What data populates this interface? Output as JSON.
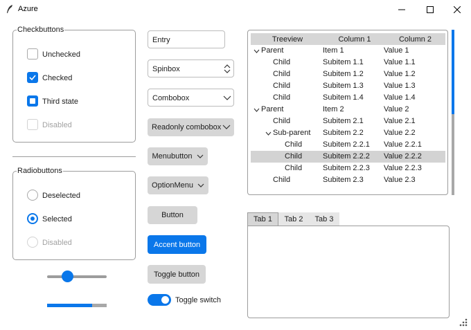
{
  "window": {
    "title": "Azure"
  },
  "checkbuttons": {
    "legend": "Checkbuttons",
    "items": [
      {
        "label": "Unchecked",
        "state": "unchecked"
      },
      {
        "label": "Checked",
        "state": "checked"
      },
      {
        "label": "Third state",
        "state": "indeterminate"
      },
      {
        "label": "Disabled",
        "state": "disabled"
      }
    ]
  },
  "radiobuttons": {
    "legend": "Radiobuttons",
    "items": [
      {
        "label": "Deselected",
        "state": "deselected"
      },
      {
        "label": "Selected",
        "state": "selected"
      },
      {
        "label": "Disabled",
        "state": "disabled"
      }
    ]
  },
  "scale": {
    "value": 0.3
  },
  "progress": {
    "value": 0.75
  },
  "widgets": {
    "entry_value": "Entry",
    "spinbox_value": "Spinbox",
    "combobox_value": "Combobox",
    "readonly_combobox_value": "Readonly combobox",
    "menubutton_label": "Menubutton",
    "optionmenu_label": "OptionMenu",
    "button_label": "Button",
    "accent_button_label": "Accent button",
    "toggle_button_label": "Toggle button",
    "toggle_switch_label": "Toggle switch",
    "toggle_switch_on": true
  },
  "treeview": {
    "headings": [
      "Treeview",
      "Column 1",
      "Column 2"
    ],
    "rows": [
      {
        "name": "Parent",
        "c1": "Item 1",
        "c2": "Value 1",
        "level": 0,
        "expander": true,
        "selected": false
      },
      {
        "name": "Child",
        "c1": "Subitem 1.1",
        "c2": "Value 1.1",
        "level": 1,
        "expander": false,
        "selected": false
      },
      {
        "name": "Child",
        "c1": "Subitem 1.2",
        "c2": "Value 1.2",
        "level": 1,
        "expander": false,
        "selected": false
      },
      {
        "name": "Child",
        "c1": "Subitem 1.3",
        "c2": "Value 1.3",
        "level": 1,
        "expander": false,
        "selected": false
      },
      {
        "name": "Child",
        "c1": "Subitem 1.4",
        "c2": "Value 1.4",
        "level": 1,
        "expander": false,
        "selected": false
      },
      {
        "name": "Parent",
        "c1": "Item 2",
        "c2": "Value 2",
        "level": 0,
        "expander": true,
        "selected": false
      },
      {
        "name": "Child",
        "c1": "Subitem 2.1",
        "c2": "Value 2.1",
        "level": 1,
        "expander": false,
        "selected": false
      },
      {
        "name": "Sub-parent",
        "c1": "Subitem 2.2",
        "c2": "Value 2.2",
        "level": 1,
        "expander": true,
        "selected": false
      },
      {
        "name": "Child",
        "c1": "Subitem 2.2.1",
        "c2": "Value 2.2.1",
        "level": 2,
        "expander": false,
        "selected": false
      },
      {
        "name": "Child",
        "c1": "Subitem 2.2.2",
        "c2": "Value 2.2.2",
        "level": 2,
        "expander": false,
        "selected": true
      },
      {
        "name": "Child",
        "c1": "Subitem 2.2.3",
        "c2": "Value 2.2.3",
        "level": 2,
        "expander": false,
        "selected": false
      },
      {
        "name": "Child",
        "c1": "Subitem 2.3",
        "c2": "Value 2.3",
        "level": 1,
        "expander": false,
        "selected": false
      }
    ]
  },
  "notebook": {
    "tabs": [
      "Tab 1",
      "Tab 2",
      "Tab 3"
    ],
    "selected_index": 0
  },
  "colors": {
    "accent": "#0a77ea",
    "button_bg": "#d6d6d6",
    "selection_bg": "#d3d3d3"
  },
  "icons": [
    "feather-icon",
    "minimize-icon",
    "maximize-icon",
    "close-icon",
    "chevron-down-icon",
    "spin-arrows-icon",
    "size-grip-icon"
  ]
}
